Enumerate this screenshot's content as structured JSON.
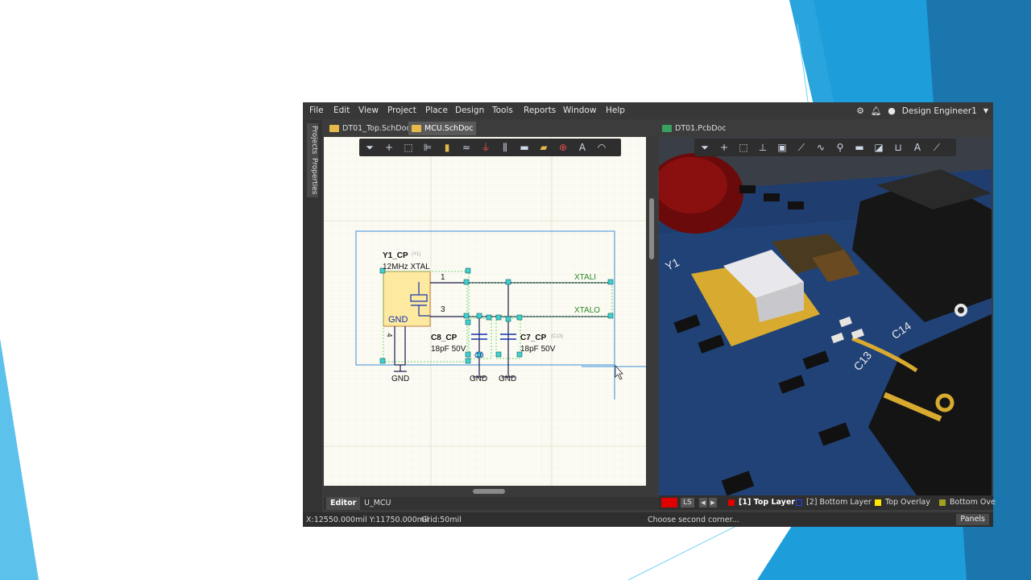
{
  "menu": {
    "items": [
      "File",
      "Edit",
      "View",
      "Project",
      "Place",
      "Design",
      "Tools",
      "Reports",
      "Window",
      "Help"
    ],
    "user": "Design Engineer1"
  },
  "side_panels": [
    "Projects",
    "Properties"
  ],
  "doc_tabs_left": [
    {
      "label": "DT01_Top.SchDoc",
      "active": false
    },
    {
      "label": "MCU.SchDoc",
      "active": true
    }
  ],
  "doc_tabs_right": [
    {
      "label": "DT01.PcbDoc",
      "active": true
    }
  ],
  "bottom_tabs": [
    {
      "label": "Editor",
      "active": true
    },
    {
      "label": "U_MCU",
      "active": false
    }
  ],
  "schematic": {
    "component_y1": {
      "designator": "Y1_CP",
      "designator_hint": "(Y1)",
      "value": "12MHz XTAL"
    },
    "component_c8": {
      "designator": "C8_CP",
      "value": "18pF 50V"
    },
    "component_c7": {
      "designator": "C7_CP",
      "designator_hint": "(C13)",
      "value": "18pF 50V"
    },
    "pin_labels": [
      "1",
      "3",
      "4",
      "GND"
    ],
    "nets": [
      "XTALI",
      "XTALO"
    ],
    "ground_labels": [
      "GND",
      "GND",
      "GND"
    ],
    "partial_text": "C0"
  },
  "pcb": {
    "silkscreen": [
      "Y1",
      "C14",
      "C13"
    ]
  },
  "layers": [
    {
      "label": "LS",
      "color": "#e00000"
    },
    {
      "label": "[1] Top Layer",
      "color": "#e00000",
      "active": true
    },
    {
      "label": "[2] Bottom Layer",
      "color": "#2040ff"
    },
    {
      "label": "Top Overlay",
      "color": "#ffe600"
    },
    {
      "label": "Bottom Ove",
      "color": "#a0a020"
    }
  ],
  "status": {
    "coords": "X:12550.000mil Y:11750.000mil",
    "grid": "Grid:50mil",
    "message": "Choose second corner...",
    "panels_button": "Panels"
  },
  "colors": {
    "accent": "#1aa7e0",
    "schematic_bg": "#fcfbf3",
    "pcb_board": "#1f3d6e"
  }
}
